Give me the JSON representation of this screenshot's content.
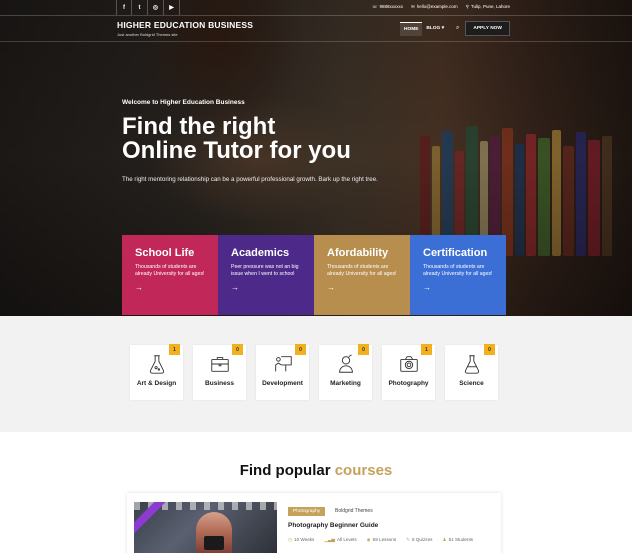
{
  "topbar": {
    "social": [
      {
        "icon": "facebook-icon",
        "glyph": "f"
      },
      {
        "icon": "twitter-icon",
        "glyph": "t"
      },
      {
        "icon": "instagram-icon",
        "glyph": "◎"
      },
      {
        "icon": "youtube-icon",
        "glyph": "▶"
      }
    ],
    "phone": "9888xxxxxx",
    "email": "hello@example.com",
    "location": "Tulip, Pune, Lahore"
  },
  "header": {
    "site_title": "HIGHER EDUCATION BUSINESS",
    "site_subtitle": "Just another Boldgrid Themes site",
    "nav": [
      "HOME",
      "BLOG ▾"
    ],
    "apply_label": "APPLY NOW"
  },
  "hero": {
    "welcome": "Welcome to Higher Education Business",
    "headline_line1": "Find the right",
    "headline_line2": "Online Tutor for you",
    "tagline": "The right mentoring relationship can be a powerful professional growth. Bark up the right tree."
  },
  "features": [
    {
      "title": "School Life",
      "desc": "Thousands of students are already University for all ages!",
      "arrow": "→",
      "color": "#c2275a"
    },
    {
      "title": "Academics",
      "desc": "Peer pressure was not an big issue when I went to school",
      "arrow": "→",
      "color": "#4d2a8a"
    },
    {
      "title": "Afordability",
      "desc": "Thousands of students are already University for all ages!",
      "arrow": "→",
      "color": "#b88e4f"
    },
    {
      "title": "Certification",
      "desc": "Thousands of students are already University for all ages!",
      "arrow": "→",
      "color": "#3b6fd6"
    }
  ],
  "categories": [
    {
      "label": "Art & Design",
      "count": "1",
      "icon": "flask-icon"
    },
    {
      "label": "Business",
      "count": "0",
      "icon": "briefcase-icon"
    },
    {
      "label": "Development",
      "count": "0",
      "icon": "presenter-icon"
    },
    {
      "label": "Marketing",
      "count": "0",
      "icon": "user-profile-icon"
    },
    {
      "label": "Photography",
      "count": "1",
      "icon": "camera-icon"
    },
    {
      "label": "Science",
      "count": "0",
      "icon": "flask-icon"
    }
  ],
  "popular": {
    "title_plain": "Find popular",
    "title_highlight": "courses"
  },
  "course": {
    "tag": "Photography",
    "author": "Boldgrid Themes",
    "title": "Photography Beginner Guide",
    "meta": [
      {
        "icon": "clock-icon",
        "glyph": "◷",
        "text": "10 Weeks"
      },
      {
        "icon": "level-icon",
        "glyph": "▁▃▅",
        "text": "All Levels"
      },
      {
        "icon": "lessons-icon",
        "glyph": "◉",
        "text": "59 Lessons"
      },
      {
        "icon": "quiz-icon",
        "glyph": "✎",
        "text": "5 Quizzes"
      },
      {
        "icon": "students-icon",
        "glyph": "♟",
        "text": "51 Students"
      }
    ]
  }
}
